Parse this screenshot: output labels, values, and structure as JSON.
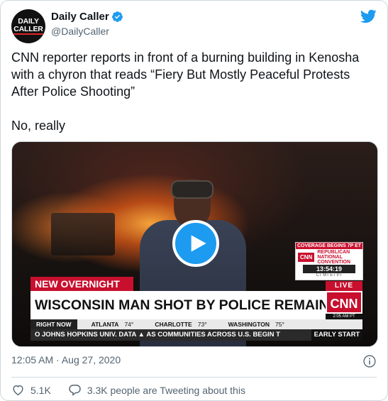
{
  "author": {
    "avatar_line1": "DAILY",
    "avatar_line2": "CALLER",
    "display_name": "Daily Caller",
    "handle": "@DailyCaller",
    "verified": true
  },
  "tweet": {
    "text_p1": "CNN reporter reports in front of a burning building in Kenosha with a chyron that reads “Fiery But Mostly Peaceful Protests After Police Shooting”",
    "text_p2": "No, really",
    "timestamp": "12:05 AM · Aug 27, 2020"
  },
  "video": {
    "coverage_banner": "COVERAGE BEGINS 7P ET",
    "mini_logo": "CNN",
    "convention_text": "REPUBLICAN NATIONAL CONVENTION",
    "clock": "13:54:19",
    "time_zones": "CT  MT  ET  PT",
    "new_overnight": "NEW OVERNIGHT",
    "live": "LIVE",
    "headline": "WISCONSIN MAN SHOT BY POLICE REMAINS IN ICU",
    "cnn_logo": "CNN",
    "cnn_time": "2:05 AM PT",
    "right_now": "RIGHT NOW",
    "weather": [
      {
        "city": "ATLANTA",
        "temp": "74°"
      },
      {
        "city": "CHARLOTTE",
        "temp": "73°"
      },
      {
        "city": "WASHINGTON",
        "temp": "75°"
      }
    ],
    "ticker": "O JOHNS HOPKINS UNIV. DATA  ▲ AS COMMUNITIES ACROSS U.S. BEGIN T",
    "early_start": "EARLY START"
  },
  "actions": {
    "likes": "5.1K",
    "conversation": "3.3K people are Tweeting about this"
  },
  "colors": {
    "twitter_blue": "#1d9bf0",
    "cnn_red": "#c8102e",
    "secondary_text": "#536471"
  },
  "icons": [
    "verified-badge-icon",
    "twitter-bird-icon",
    "play-icon",
    "info-icon",
    "heart-icon",
    "comment-icon"
  ]
}
